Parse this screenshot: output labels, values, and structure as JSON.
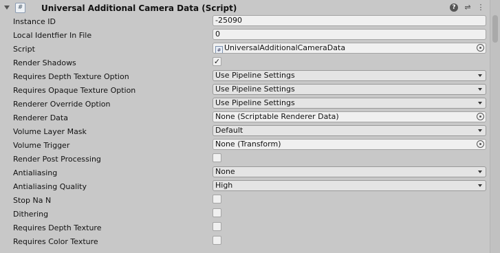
{
  "component": {
    "title": "Universal Additional Camera Data (Script)",
    "script_icon": "#",
    "icons": {
      "foldout": "foldout-arrow-icon",
      "help": "?",
      "presets": "⇌",
      "menu": "⋮"
    }
  },
  "fields": [
    {
      "label": "Instance ID",
      "kind": "text",
      "value": "-25090"
    },
    {
      "label": "Local Identfier In File",
      "kind": "text",
      "value": "0"
    },
    {
      "label": "Script",
      "kind": "object",
      "value": "UniversalAdditionalCameraData",
      "icon": "#"
    },
    {
      "label": "Render Shadows",
      "kind": "toggle",
      "checked": true
    },
    {
      "label": "Requires Depth Texture Option",
      "kind": "dropdown",
      "value": "Use Pipeline Settings"
    },
    {
      "label": "Requires Opaque Texture Option",
      "kind": "dropdown",
      "value": "Use Pipeline Settings"
    },
    {
      "label": "Renderer Override Option",
      "kind": "dropdown",
      "value": "Use Pipeline Settings"
    },
    {
      "label": "Renderer Data",
      "kind": "object",
      "value": "None (Scriptable Renderer Data)"
    },
    {
      "label": "Volume Layer Mask",
      "kind": "dropdown",
      "value": "Default"
    },
    {
      "label": "Volume Trigger",
      "kind": "object",
      "value": "None (Transform)"
    },
    {
      "label": "Render Post Processing",
      "kind": "toggle",
      "checked": false
    },
    {
      "label": "Antialiasing",
      "kind": "dropdown",
      "value": "None"
    },
    {
      "label": "Antialiasing Quality",
      "kind": "dropdown",
      "value": "High"
    },
    {
      "label": "Stop Na N",
      "kind": "toggle",
      "checked": false
    },
    {
      "label": "Dithering",
      "kind": "toggle",
      "checked": false
    },
    {
      "label": "Requires Depth Texture",
      "kind": "toggle",
      "checked": false
    },
    {
      "label": "Requires Color Texture",
      "kind": "toggle",
      "checked": false
    }
  ],
  "check_glyph": "✓"
}
